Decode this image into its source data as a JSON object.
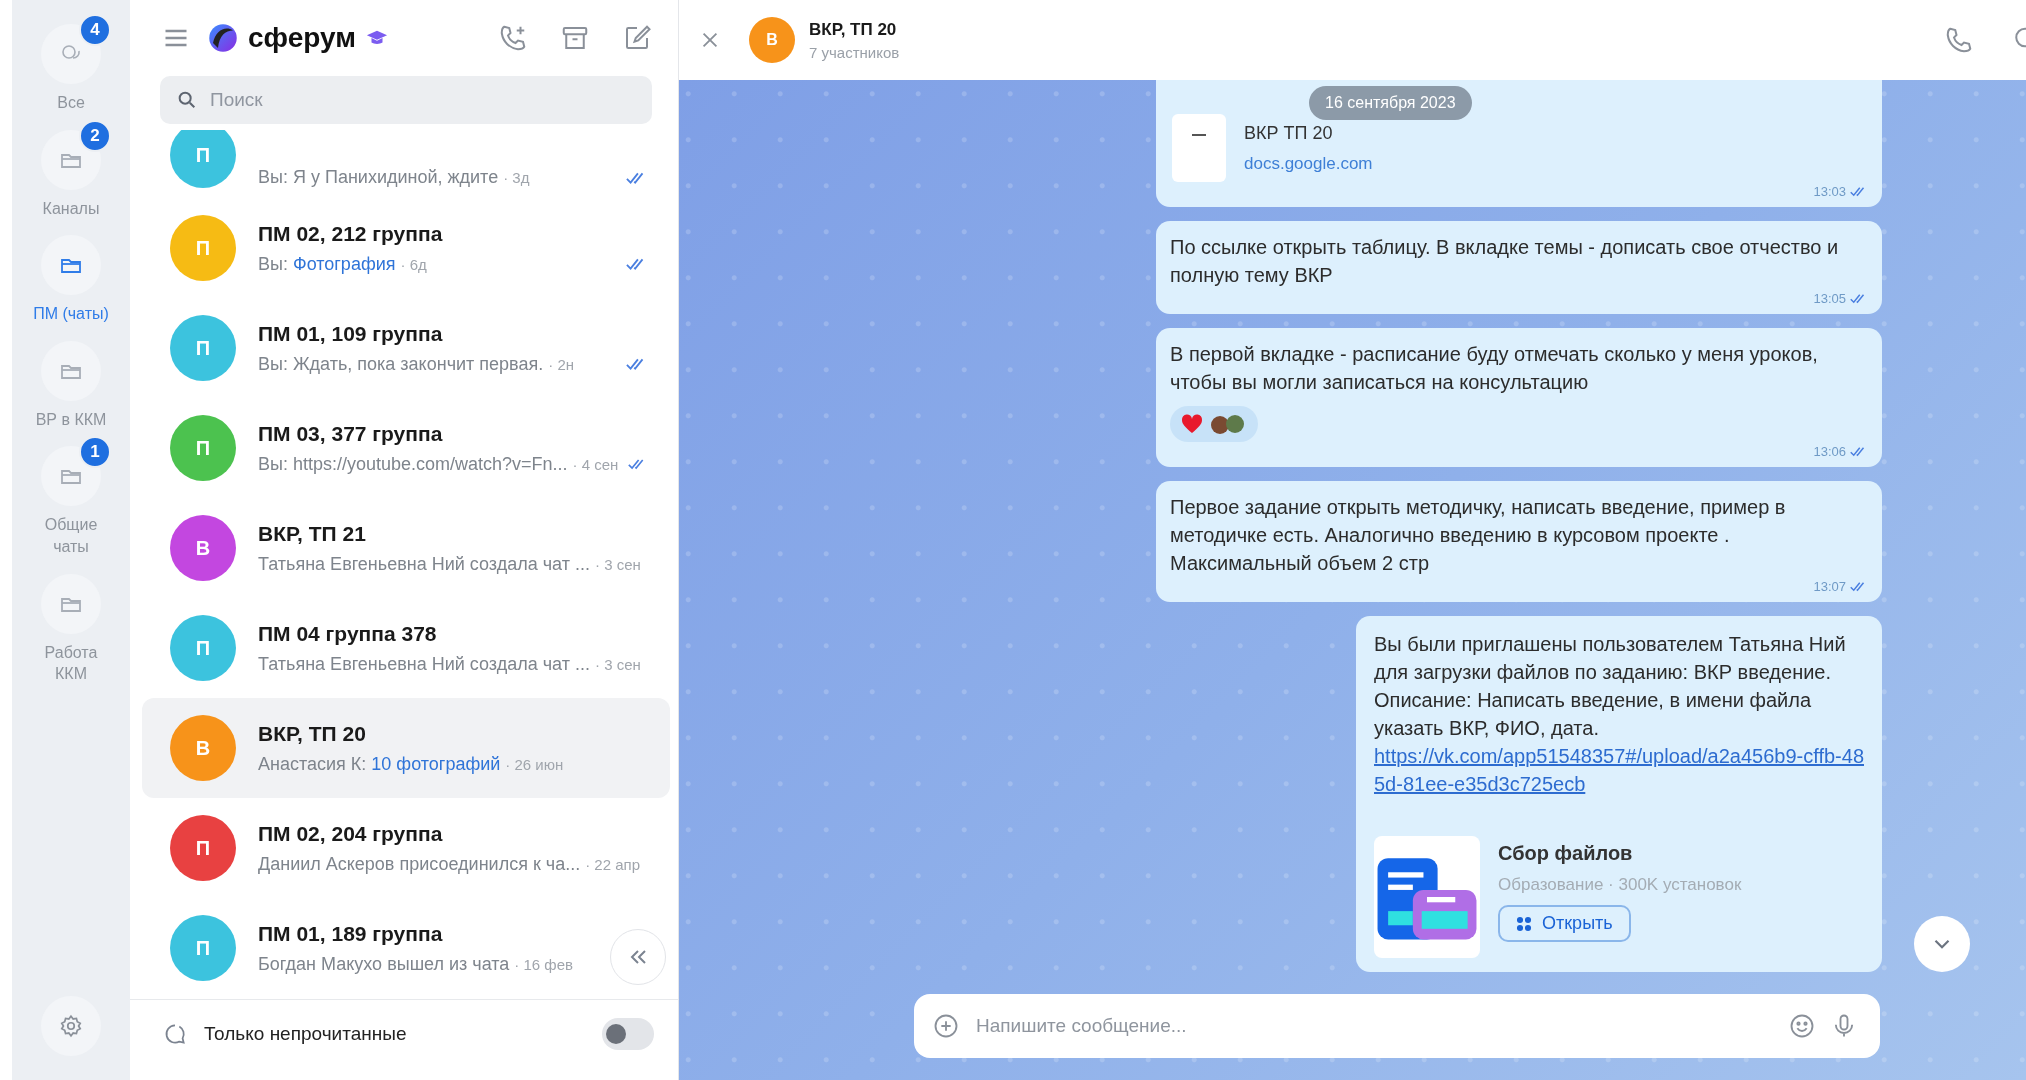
{
  "rail": {
    "items": [
      {
        "label": "Все",
        "kind": "chats",
        "badge": "4",
        "selected": false
      },
      {
        "label": "Каналы",
        "kind": "folder",
        "badge": "2",
        "selected": false
      },
      {
        "label": "ПМ (чаты)",
        "kind": "folder",
        "selected": true
      },
      {
        "label": "ВР в ККМ",
        "kind": "folder",
        "selected": false
      },
      {
        "label": "Общие чаты",
        "kind": "folder",
        "badge": "1",
        "selected": false
      },
      {
        "label": "Работа ККМ",
        "kind": "folder",
        "selected": false
      }
    ]
  },
  "app": {
    "logo": "сферум"
  },
  "search": {
    "placeholder": "Поиск"
  },
  "chats": [
    {
      "preview": {
        "sender": "Вы:",
        "text": "Я у Панихидиной, ждите",
        "media": false
      },
      "time": "· 3д",
      "read": true,
      "avatar": "П",
      "color": "#3cc3de",
      "selected": false,
      "cut": true
    },
    {
      "title": "ПМ 02, 212 группа",
      "preview": {
        "sender": "Вы:",
        "text": "Фотография",
        "media": true
      },
      "time": "· 6д",
      "read": true,
      "avatar": "П",
      "color": "#f6bb14",
      "selected": false,
      "cut": false
    },
    {
      "title": "ПМ 01, 109 группа",
      "preview": {
        "sender": "Вы:",
        "text": "Ждать, пока закончит первая.",
        "media": false
      },
      "time": "· 2н",
      "read": true,
      "avatar": "П",
      "color": "#3cc3de",
      "selected": false,
      "cut": false
    },
    {
      "title": "ПМ 03, 377 группа",
      "preview": {
        "sender": "Вы:",
        "text": "https://youtube.com/watch?v=Fn...",
        "media": false
      },
      "time": "· 4 сен",
      "read": true,
      "avatar": "П",
      "color": "#4cc24f",
      "selected": false,
      "cut": false
    },
    {
      "title": "ВКР, ТП 21",
      "preview": {
        "text": "Татьяна Евгеньевна Ний создала чат ...",
        "media": false
      },
      "time": "· 3 сен",
      "read": false,
      "avatar": "В",
      "color": "#c347e0",
      "selected": false,
      "cut": false
    },
    {
      "title": "ПМ 04 группа 378",
      "preview": {
        "text": "Татьяна Евгеньевна Ний создала чат ...",
        "media": false
      },
      "time": "· 3 сен",
      "read": false,
      "avatar": "П",
      "color": "#3cc3de",
      "selected": false,
      "cut": false
    },
    {
      "title": "ВКР, ТП 20",
      "preview": {
        "sender": "Анастасия К:",
        "text": "10 фотографий",
        "media": true
      },
      "time": "· 26 июн",
      "read": false,
      "avatar": "В",
      "color": "#f7931a",
      "selected": true,
      "cut": false
    },
    {
      "title": "ПМ 02, 204 группа",
      "preview": {
        "text": "Даниил Аскеров присоединился к ча...",
        "media": false
      },
      "time": "· 22 апр",
      "read": false,
      "avatar": "П",
      "color": "#e84141",
      "selected": false,
      "cut": false
    },
    {
      "title": "ПМ 01, 189 группа",
      "preview": {
        "text": "Богдан Макухо вышел из чата",
        "media": false
      },
      "time": "· 16 фев",
      "read": false,
      "avatar": "П",
      "color": "#3cc3de",
      "selected": false,
      "cut": false
    }
  ],
  "filter": {
    "label": "Только непрочитанные",
    "on": false
  },
  "chat": {
    "avatar": "В",
    "title": "ВКР, ТП 20",
    "subtitle": "7 участников",
    "date": "16 сентября 2023",
    "messages": [
      {
        "kind": "link",
        "title": "ВКР ТП 20",
        "domain": "docs.google.com",
        "time": "13:03",
        "read": true
      },
      {
        "kind": "text",
        "text": "По ссылке открыть таблицу. В вкладке темы - дописать свое отчество и полную тему ВКР",
        "time": "13:05",
        "read": true
      },
      {
        "kind": "text",
        "text": "В первой вкладке - расписание буду отмечать сколько у меня уроков, чтобы вы могли записаться на консультацию",
        "reactions": [
          {
            "kind": "heart"
          },
          {
            "kind": "sticker"
          }
        ],
        "time": "13:06",
        "read": true
      },
      {
        "kind": "text",
        "text": "Первое задание открыть методичку, написать введение, пример в методичке есть. Аналогично введению в курсовом проекте . Максимальный объем 2 стр",
        "time": "13:07",
        "read": true
      },
      {
        "kind": "invite",
        "paragraphs": [
          "Вы были приглашены пользователем Татьяна Ний для загрузки файлов по заданию: ВКР введение.",
          "Описание: Написать введение, в имени файла указать ВКР, ФИО, дата."
        ],
        "link": "https://vk.com/app51548357#/upload/a2a456b9-cffb-485d-81ee-e35d3c725ecb",
        "app": {
          "title": "Сбор файлов",
          "subtitle": "Образование · 300K установок",
          "button": "Открыть"
        }
      }
    ]
  },
  "composer": {
    "placeholder": "Напишите сообщение..."
  }
}
